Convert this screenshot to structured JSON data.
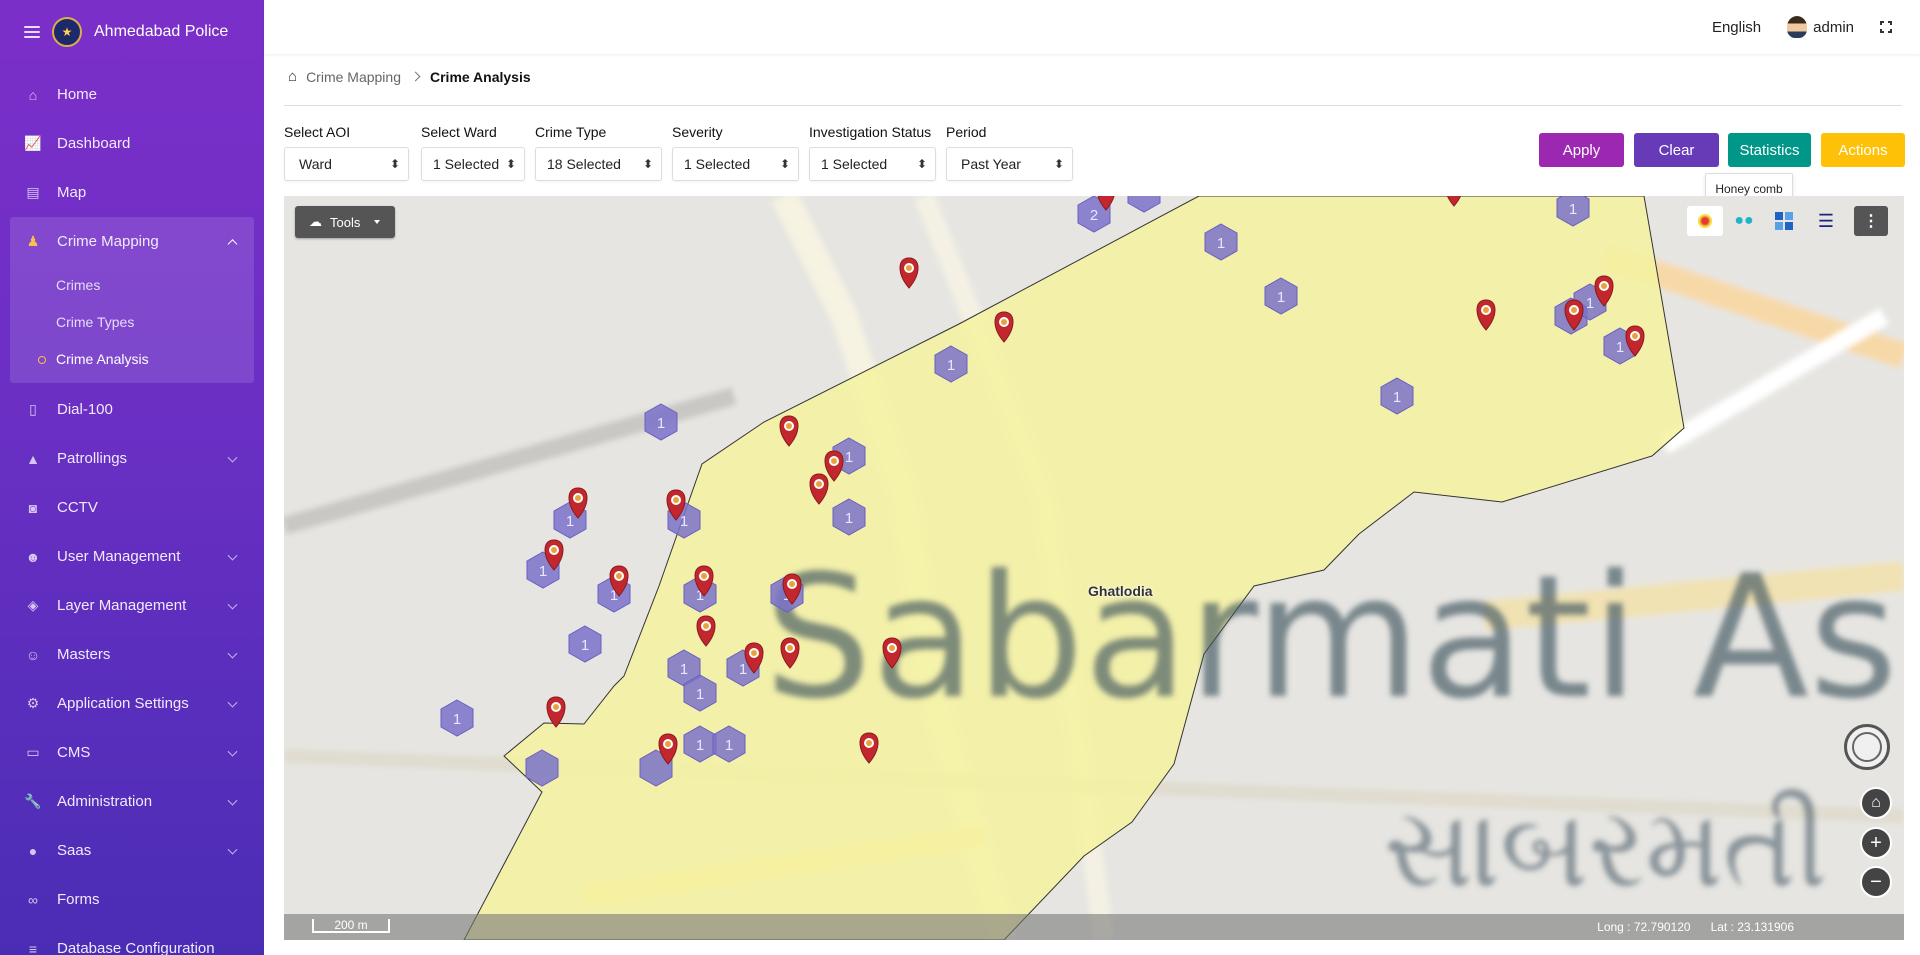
{
  "app": {
    "title": "Ahmedabad Police"
  },
  "sidebar": {
    "items": [
      {
        "label": "Home",
        "icon": "home-icon"
      },
      {
        "label": "Dashboard",
        "icon": "chart-icon"
      },
      {
        "label": "Map",
        "icon": "map-icon"
      },
      {
        "label": "Crime Mapping",
        "icon": "crime-icon",
        "expanded": true,
        "children": [
          "Crimes",
          "Crime Types",
          "Crime Analysis"
        ]
      },
      {
        "label": "Dial-100",
        "icon": "file-icon"
      },
      {
        "label": "Patrollings",
        "icon": "road-icon"
      },
      {
        "label": "CCTV",
        "icon": "camera-icon"
      },
      {
        "label": "User Management",
        "icon": "users-icon"
      },
      {
        "label": "Layer Management",
        "icon": "layers-icon"
      },
      {
        "label": "Masters",
        "icon": "group-icon"
      },
      {
        "label": "Application Settings",
        "icon": "gears-icon"
      },
      {
        "label": "CMS",
        "icon": "cms-icon"
      },
      {
        "label": "Administration",
        "icon": "wrench-icon"
      },
      {
        "label": "Saas",
        "icon": "globe-icon"
      },
      {
        "label": "Forms",
        "icon": "link-icon"
      },
      {
        "label": "Database Configuration",
        "icon": "database-icon"
      }
    ]
  },
  "topbar": {
    "language": "English",
    "username": "admin"
  },
  "breadcrumb": {
    "parent": "Crime Mapping",
    "current": "Crime Analysis"
  },
  "filters": {
    "aoi": {
      "label": "Select AOI",
      "value": "Ward"
    },
    "ward": {
      "label": "Select Ward",
      "value": "1 Selected"
    },
    "crime_type": {
      "label": "Crime Type",
      "value": "18 Selected"
    },
    "severity": {
      "label": "Severity",
      "value": "1 Selected"
    },
    "investigation": {
      "label": "Investigation Status",
      "value": "1 Selected"
    },
    "period": {
      "label": "Period",
      "value": "Past Year"
    }
  },
  "actions": {
    "apply": "Apply",
    "clear": "Clear",
    "statistics": "Statistics",
    "actions": "Actions",
    "colors": {
      "apply": "#9c27b0",
      "clear": "#673ab7",
      "statistics": "#009688",
      "actions": "#ffc107"
    }
  },
  "tooltip": "Honey comb",
  "map": {
    "tools_label": "Tools",
    "place_label": "Ghatlodia",
    "watermark_text": "Sabarmati As",
    "watermark_text_gu": "સાબરમતી",
    "scale": "200 m",
    "longitude": "Long : 72.790120",
    "latitude": "Lat : 23.131906",
    "hex_count_label": "1",
    "hex_count_label_2": "2"
  }
}
